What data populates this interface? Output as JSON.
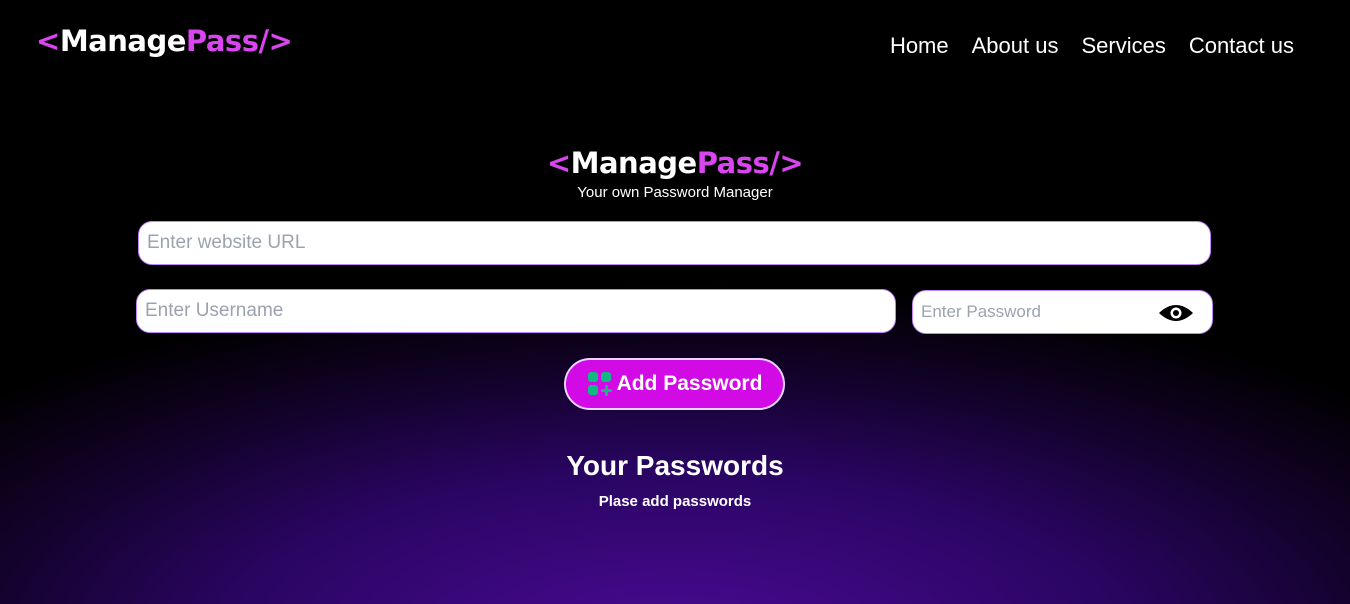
{
  "brand": {
    "open": "<",
    "manage": "Manage",
    "pass": "Pass/>"
  },
  "nav": {
    "items": [
      "Home",
      "About us",
      "Services",
      "Contact us"
    ]
  },
  "hero": {
    "tagline": "Your own Password Manager"
  },
  "form": {
    "url_placeholder": "Enter website URL",
    "username_placeholder": "Enter Username",
    "password_placeholder": "Enter Password",
    "add_label": "Add Password"
  },
  "passwords": {
    "heading": "Your Passwords",
    "empty_message": "Plase add passwords"
  },
  "icons": {
    "password_toggle": "eye-icon",
    "add_button": "add-grid-icon"
  },
  "colors": {
    "accent": "#d946ef",
    "button": "#d10ae6",
    "icon_green": "#10b981",
    "glow": "#4a0a94"
  }
}
